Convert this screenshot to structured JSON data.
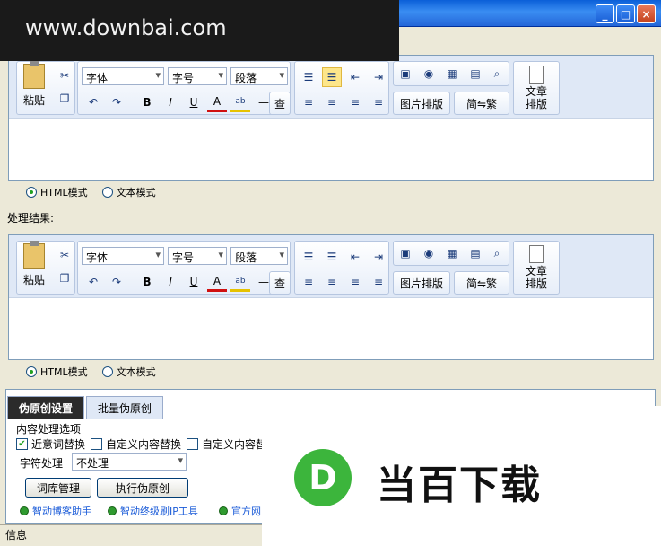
{
  "watermark": "www.downbai.com",
  "window_buttons": {
    "min": "_",
    "max": "□",
    "close": "×"
  },
  "toolbar": {
    "paste": "粘贴",
    "font": "字体",
    "size": "字号",
    "paragraph": "段落",
    "image_layout": "图片排版",
    "convert": "简⇋繁",
    "article_layout_line1": "文章",
    "article_layout_line2": "排版",
    "find": "查"
  },
  "modes": {
    "html": "HTML模式",
    "text": "文本模式"
  },
  "result_label": "处理结果:",
  "tabs": [
    "伪原创设置",
    "批量伪原创"
  ],
  "options": {
    "title": "内容处理选项",
    "synonym": "近意词替换",
    "custom1": "自定义内容替换",
    "custom2": "自定义内容替",
    "char_label": "字符处理",
    "char_value": "不处理"
  },
  "buttons": {
    "lexicon": "词库管理",
    "run": "执行伪原创"
  },
  "links": [
    "智动博客助手",
    "智动终级刷IP工具",
    "官方网"
  ],
  "status": "信息",
  "logo": {
    "letter": "D",
    "text": "当百下载"
  }
}
